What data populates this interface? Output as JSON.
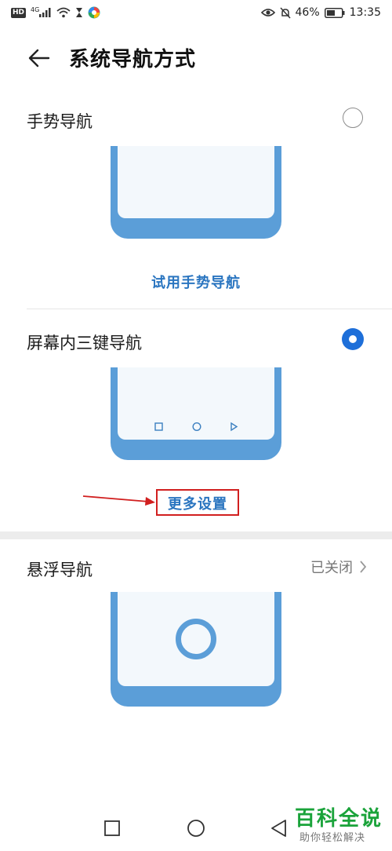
{
  "status_bar": {
    "network_badge": "HD",
    "network_gen": "4G",
    "battery_percent": "46%",
    "time": "13:35"
  },
  "header": {
    "title": "系统导航方式"
  },
  "options": {
    "gesture": {
      "label": "手势导航",
      "selected": false,
      "link": "试用手势导航"
    },
    "three_key": {
      "label": "屏幕内三键导航",
      "selected": true,
      "link": "更多设置"
    },
    "floating": {
      "label": "悬浮导航",
      "status": "已关闭"
    }
  },
  "watermark": {
    "title": "百科全说",
    "subtitle": "助你轻松解决"
  },
  "colors": {
    "accent": "#1e6fd9",
    "phone": "#5b9ed8",
    "annotation": "#d11f1f",
    "watermark": "#1aa33a"
  }
}
